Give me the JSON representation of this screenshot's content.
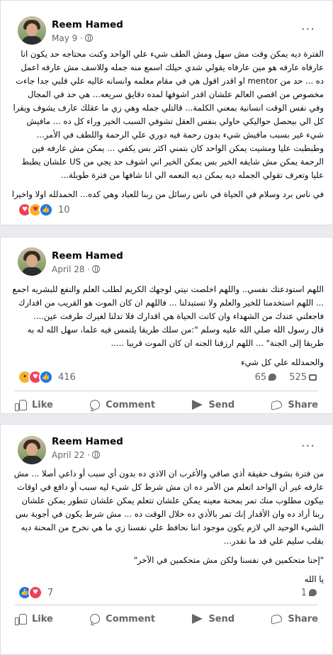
{
  "posts": [
    {
      "author": "Reem Hamed",
      "date": "May 9 ·",
      "more": "···",
      "paragraphs": [
        "الفترة ديه يمكن وقت مش سهل ومش الطف شيء علي الواحد وكنت محتاجه حد يكون انا عارفاه عارفه هو مين عارفاه يقولي شدي حيلك اسمع منه جمله وللاسف مش عارفه اعمل ده ... حد من mentor او اقدر اقول هي في مقام معلمه وانسانه غاليه علي قلبي جدا جاءت مخصوص من اقصي العالم علشان اقدر اشوفها لمده دقايق سريعه... هي حد في المجال وفي نفس الوقت انسانية بمعني الكلمة... قالتلي جمله وهي زي ما عقلك عارف يشوف ويقرا كل الي بيحصل حواليكي حاولي بنفس العقل تشوفي السبب الخير وراء كل ده ... مافيش شيء غير بسبب مافيش شيء بدون رحمة فيه دوري علي الرحمة واللطف في الأمر... وطبطبت عليا ومشيت يمكن الواحد كان بتمني اكثر بس يكفي ... يمكن مش عارفه فين الرحمة يمكن مش شايفه الخير بس يمكن الخير اني اشوف حد يجي من US علشان يطبط عليا وتعرف تقولي الجمله ديه يمكن ديه النعمه الي انا شافها من فترة طويلة...",
        "في ناس برد وسلام في الحياة في ناس رسائل من ربنا للعباد وهي كده... الحمدلله اولا واخيرا"
      ],
      "reaction_count": "10",
      "comments": "",
      "shares": ""
    },
    {
      "author": "Reem Hamed",
      "date": "April 28 ·",
      "more": "···",
      "paragraphs": [
        "اللهم استودعتك نفسي.. واللهم اخلصت نيتي لوجهك الكريم لطلب العلم والنفع للبشريه اجمع ... اللهم استخدمنا للخير والعلم ولا تستبدلنا ... فاللهم ان كان الموت هو القريب من اقدارك فاجعلني عندك من الشهداء وان كانت الحياة هي اقدارك فلا تدلنا لغيرك طرفت عين....",
        "قال رسول الله صلي الله عليه وسلم \":من سلك طريقا يلتمس فيه علما، سهل الله له به طريقا إلى الجنة\" ... اللهم ارزقنا الجنه ان كان الموت قريبا .....",
        "والحمدلله علي كل شيء"
      ],
      "reaction_count": "416",
      "comments": "65",
      "shares": "525"
    },
    {
      "author": "Reem Hamed",
      "date": "April 22 ·",
      "more": "···",
      "paragraphs": [
        "من فترة بشوف حقيقة أذي صافي والأغرب ان الاذي ده بدون أي سبب أو داعي أصلا ... مش عارفه غير أن الواحد اتعلم من الأمر ده ان مش شرط كل شيء ليه سبب أو دافع في اوقات بيكون مطلوب منك تمر بمحنة معينه يمكن علشان تتعلم يمكن علشان تتطور يمكن علشان ربنا أراد ده وان الأقدار إنك تمر بالأذي ده خلال الوقت ده ... مش شرط يكون في أجوبة بس الشيء الوحيد الي لازم يكون موجود اننا نحافظ علي نفسنا زي ما هي نخرج من المحنة ديه بقلب سليم علي قد ما نقدر...",
        "\"إحنا متحكمين في نفسنا ولكن مش متحكمين في الآخر\"",
        "يا الله"
      ],
      "reaction_count": "7",
      "comments": "1",
      "shares": ""
    }
  ],
  "actions": {
    "like": "Like",
    "comment": "Comment",
    "send": "Send",
    "share": "Share"
  }
}
